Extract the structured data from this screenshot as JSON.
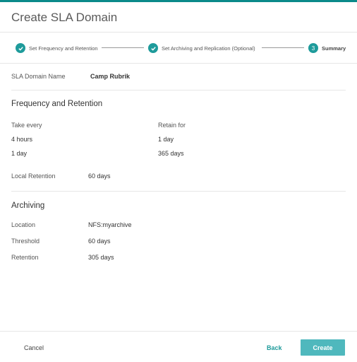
{
  "dialog": {
    "title": "Create SLA Domain"
  },
  "wizard": {
    "steps": [
      {
        "number": "1",
        "label": "Set Frequency and Retention",
        "state": "completed"
      },
      {
        "number": "2",
        "label": "Set Archiving and Replication (Optional)",
        "state": "completed"
      },
      {
        "number": "3",
        "label": "Summary",
        "state": "active"
      }
    ]
  },
  "summary": {
    "name_label": "SLA Domain Name",
    "name_value": "Camp Rubrik",
    "frequency": {
      "title": "Frequency and Retention",
      "take_every_header": "Take every",
      "retain_for_header": "Retain for",
      "rows": [
        {
          "take_every": "4 hours",
          "retain_for": "1 day"
        },
        {
          "take_every": "1 day",
          "retain_for": "365 days"
        }
      ],
      "local_retention_label": "Local Retention",
      "local_retention_value": "60 days"
    },
    "archiving": {
      "title": "Archiving",
      "location_label": "Location",
      "location_value": "NFS:myarchive",
      "threshold_label": "Threshold",
      "threshold_value": "60 days",
      "retention_label": "Retention",
      "retention_value": "305 days"
    }
  },
  "footer": {
    "cancel_label": "Cancel",
    "back_label": "Back",
    "create_label": "Create"
  },
  "colors": {
    "accent": "#1e9b9b",
    "top_bar": "#0b8a8a",
    "create_button": "#4fb8bd"
  }
}
